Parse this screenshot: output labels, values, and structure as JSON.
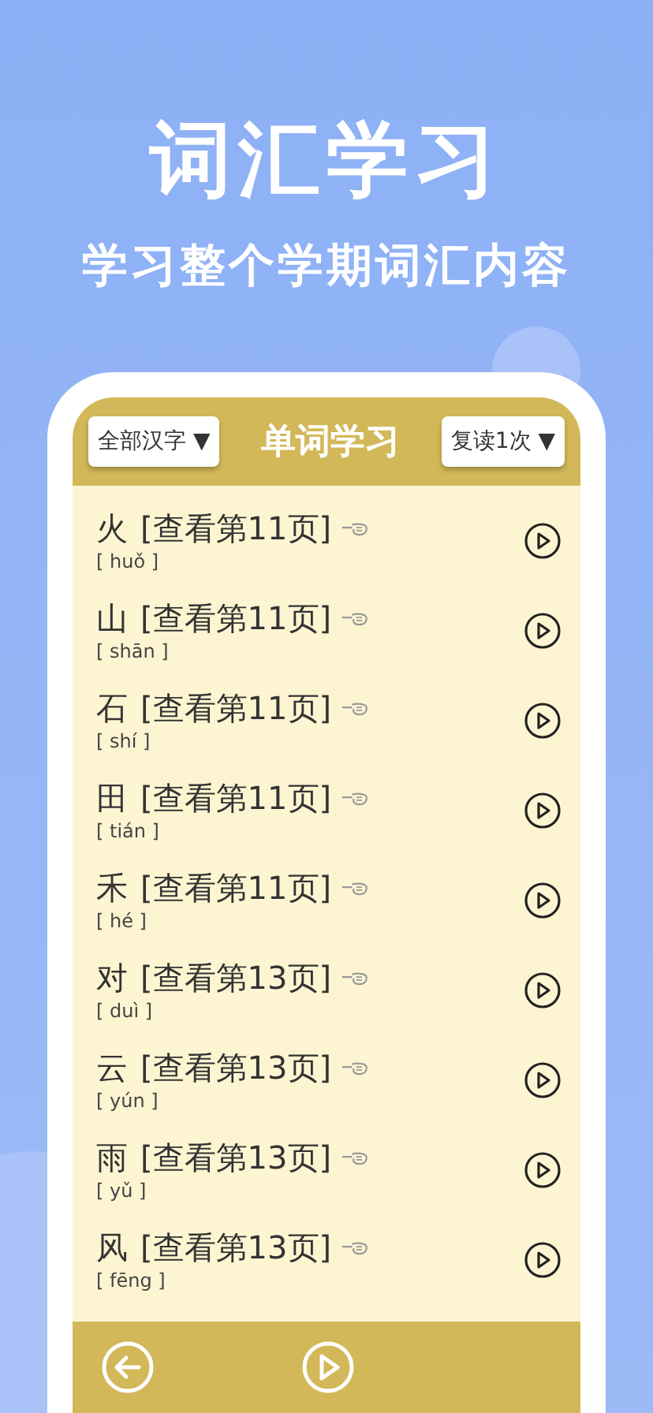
{
  "headline": "词汇学习",
  "subtitle": "学习整个学期词汇内容",
  "header": {
    "filter": "全部汉字 ▼",
    "title": "单词学习",
    "repeat": "复读1次 ▼"
  },
  "words": [
    {
      "char": "火",
      "page": "[查看第11页]",
      "pinyin": "[ huǒ ]"
    },
    {
      "char": "山",
      "page": "[查看第11页]",
      "pinyin": "[ shān ]"
    },
    {
      "char": "石",
      "page": "[查看第11页]",
      "pinyin": "[ shí ]"
    },
    {
      "char": "田",
      "page": "[查看第11页]",
      "pinyin": "[ tián ]"
    },
    {
      "char": "禾",
      "page": "[查看第11页]",
      "pinyin": "[ hé ]"
    },
    {
      "char": "对",
      "page": "[查看第13页]",
      "pinyin": "[ duì ]"
    },
    {
      "char": "云",
      "page": "[查看第13页]",
      "pinyin": "[ yún ]"
    },
    {
      "char": "雨",
      "page": "[查看第13页]",
      "pinyin": "[ yǔ ]"
    },
    {
      "char": "风",
      "page": "[查看第13页]",
      "pinyin": "[ fēng ]"
    }
  ]
}
